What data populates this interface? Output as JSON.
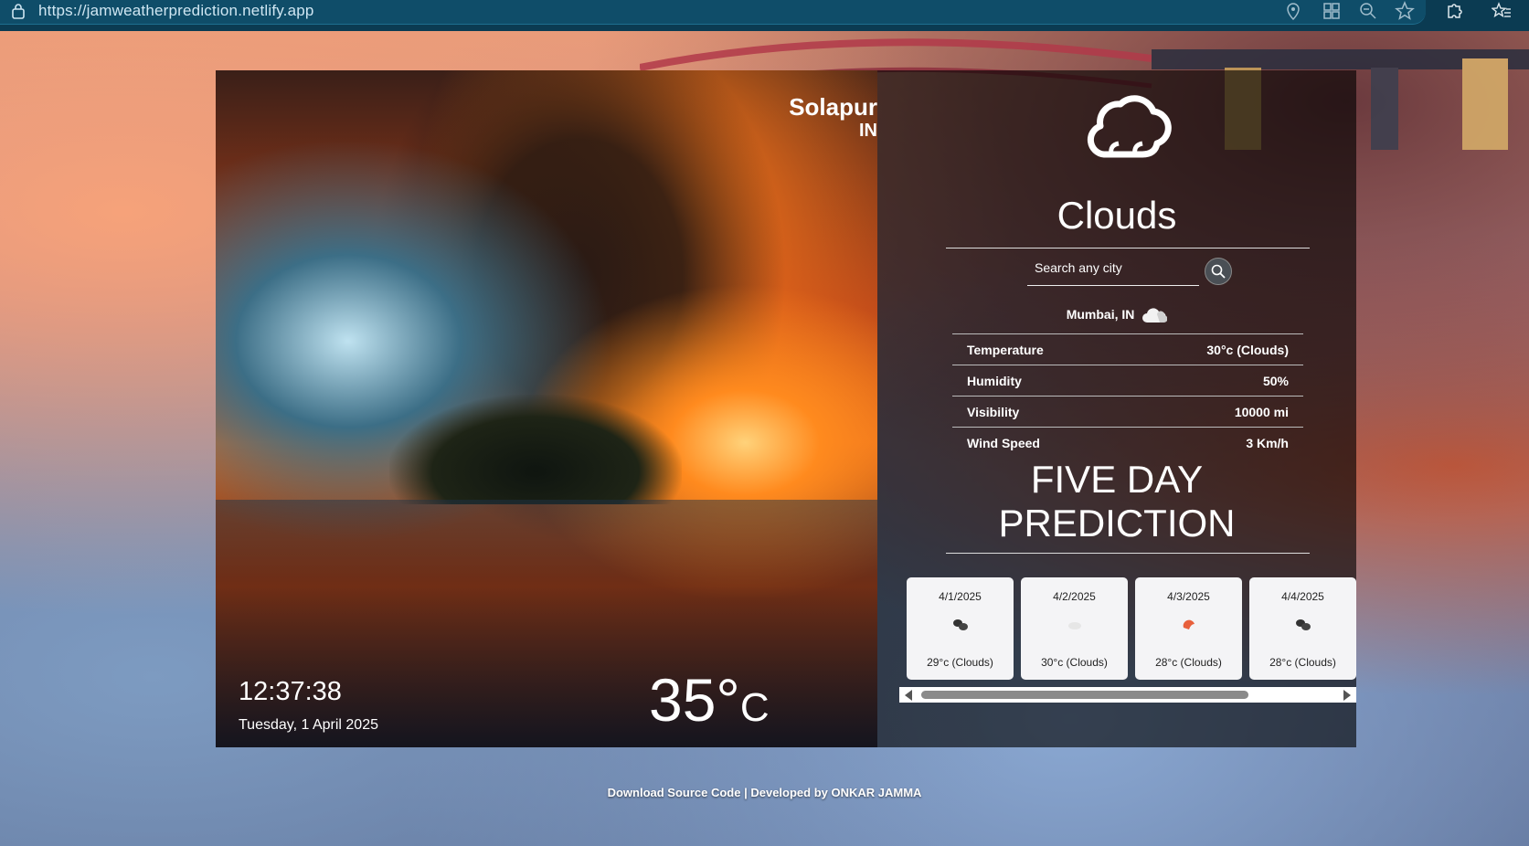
{
  "browser": {
    "url": "https://jamweatherprediction.netlify.app",
    "icons": [
      "lock-icon",
      "location-icon",
      "apps-icon",
      "zoom-out-icon",
      "favorite-star-icon",
      "extensions-icon",
      "favorites-list-icon"
    ]
  },
  "left": {
    "city": "Solapur",
    "country": "IN",
    "time": "12:37:38",
    "date": "Tuesday, 1 April 2025",
    "temperature": "35°",
    "temperature_unit": "C"
  },
  "right": {
    "condition_icon": "cloud-icon",
    "condition": "Clouds",
    "search": {
      "placeholder": "Search any city",
      "value": ""
    },
    "location_line": "Mumbai, IN",
    "stats": [
      {
        "label": "Temperature",
        "value": "30°c (Clouds)"
      },
      {
        "label": "Humidity",
        "value": "50%"
      },
      {
        "label": "Visibility",
        "value": "10000 mi"
      },
      {
        "label": "Wind Speed",
        "value": "3 Km/h"
      }
    ],
    "forecast_title": "FIVE DAY PREDICTION",
    "forecast": [
      {
        "date": "4/1/2025",
        "temp": "29°c (Clouds)",
        "icon": "broken-clouds-icon",
        "icon_color": "#333333"
      },
      {
        "date": "4/2/2025",
        "temp": "30°c (Clouds)",
        "icon": "few-clouds-icon",
        "icon_color": "#e6e6e6"
      },
      {
        "date": "4/3/2025",
        "temp": "28°c (Clouds)",
        "icon": "scattered-clouds-icon",
        "icon_color": "#e8603c"
      },
      {
        "date": "4/4/2025",
        "temp": "28°c (Clouds)",
        "icon": "broken-clouds-icon",
        "icon_color": "#333333"
      }
    ]
  },
  "footer": {
    "text": "Download Source Code | Developed by ONKAR JAMMA"
  }
}
